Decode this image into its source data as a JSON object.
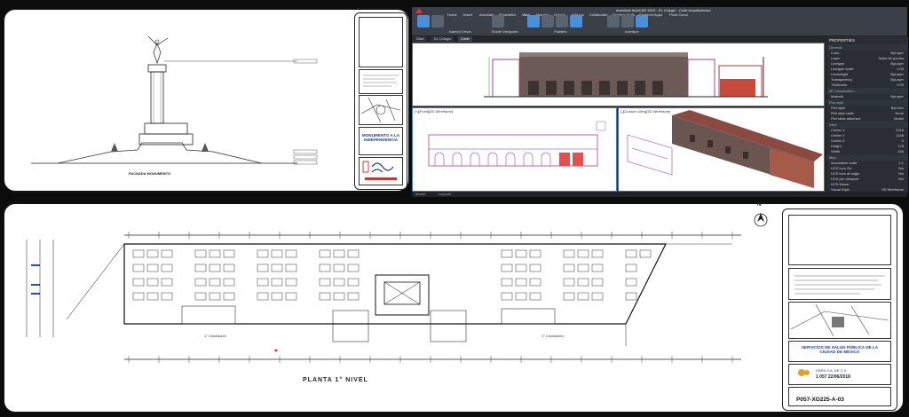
{
  "sheet1": {
    "caption": "FACHADA MONUMENTO",
    "title_block": {
      "top_label": "MONUMENTO A LA",
      "project_title": "MONUMENTO A LA INDEPENDENCIA"
    }
  },
  "sheet2": {
    "plan_title": "PLANTA 1° NIVEL",
    "north_label": "N",
    "zone_left": "1° Circulación",
    "zone_right": "1° Circulación",
    "title_block": {
      "project_title": "SERVICIOS DE SALUD PÚBLICA DE LA CIUDAD DE MÉXICO",
      "company": "OBRA S.A. DE C.V.",
      "date": "1 057 22/06/2018",
      "sheet_number": "P057-XO225-A-03"
    }
  },
  "cad": {
    "window_title": "Autodesk AutoCAD 2019 - Ex Colegio - Corte Arquitectónico",
    "ribbon_tabs": [
      "Home",
      "Insert",
      "Annotate",
      "Parametric",
      "View",
      "Manage",
      "Output",
      "Add-ins",
      "Collaborate",
      "Express Tools",
      "Featured Apps",
      "Point Cloud"
    ],
    "ribbon_labels": [
      "Named Views",
      "Model Viewports",
      "Palettes",
      "Interface"
    ],
    "doc_tabs": [
      "Start",
      "Ex Colegio",
      "Corte"
    ],
    "viewport_front_label": "[+][Front][2D Wireframe]",
    "viewport_3d_label": "[-][Custom View][3D Wireframe]",
    "properties": {
      "title": "PROPERTIES",
      "sections": [
        {
          "name": "General",
          "rows": [
            [
              "Color",
              "ByLayer"
            ],
            [
              "Layer",
              "Nube de puntos"
            ],
            [
              "Linetype",
              "ByLayer"
            ],
            [
              "Linetype scale",
              "1.00"
            ],
            [
              "Lineweight",
              "ByLayer"
            ],
            [
              "Transparency",
              "ByLayer"
            ],
            [
              "Thickness",
              "0.00"
            ]
          ]
        },
        {
          "name": "3D Visualization",
          "rows": [
            [
              "Material",
              "ByLayer"
            ]
          ]
        },
        {
          "name": "Plot style",
          "rows": [
            [
              "Plot style",
              "ByColor"
            ],
            [
              "Plot style table",
              "None"
            ],
            [
              "Plot table attached",
              "Model"
            ]
          ]
        },
        {
          "name": "View",
          "rows": [
            [
              "Center X",
              "2216"
            ],
            [
              "Center Y",
              "1108"
            ],
            [
              "Center Z",
              "0"
            ],
            [
              "Height",
              "178"
            ],
            [
              "Width",
              "436"
            ]
          ]
        },
        {
          "name": "Misc",
          "rows": [
            [
              "Annotation scale",
              "1:1"
            ],
            [
              "UCS icon On",
              "Yes"
            ],
            [
              "UCS icon at origin",
              "Yes"
            ],
            [
              "UCS per viewport",
              "Yes"
            ],
            [
              "UCS Name",
              ""
            ],
            [
              "Visual Style",
              "2D Wireframe"
            ]
          ]
        }
      ]
    },
    "status": {
      "model_tab": "Model",
      "layout_tab": "Layout1"
    }
  }
}
